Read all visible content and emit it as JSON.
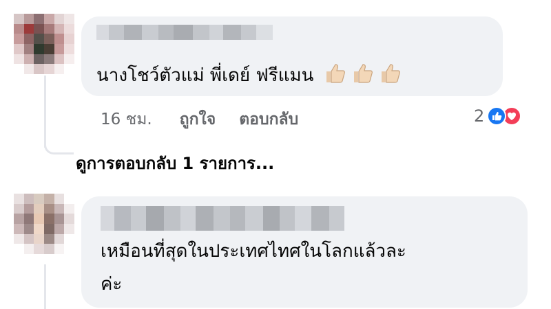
{
  "comments": [
    {
      "text": "นางโชว์ตัวแม่ พี่เดย์ ฟรีแมน",
      "emoji": "thumbs-up x3",
      "time": "16 ชม.",
      "like_label": "ถูกใจ",
      "reply_label": "ตอบกลับ",
      "reaction_count": "2",
      "reactions": [
        "like-icon",
        "love-icon"
      ],
      "view_replies": "ดูการตอบกลับ 1 รายการ..."
    },
    {
      "text_line1": "เหมือนที่สุดในประเทศไทศในโลกแล้วละ",
      "text_line2": "ค่ะ"
    }
  ],
  "colors": {
    "bubble": "#f0f2f5",
    "meta": "#65676b",
    "like": "#1877f2",
    "love": "#f33e58"
  }
}
